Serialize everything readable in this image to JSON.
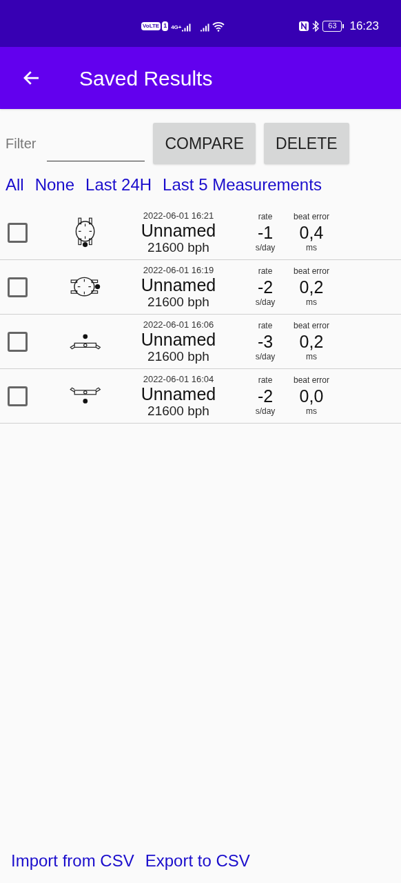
{
  "status_bar": {
    "volte": "VoLTE",
    "sim": "1",
    "network": "4G+",
    "battery": "63",
    "time": "16:23"
  },
  "app_bar": {
    "title": "Saved Results"
  },
  "filter": {
    "label": "Filter",
    "buttons": [
      "COMPARE",
      "DELETE"
    ]
  },
  "quick_select": [
    "All",
    "None",
    "Last 24H",
    "Last 5 Measurements"
  ],
  "results": [
    {
      "checked": false,
      "kind": "crown_down",
      "date": "2022-06-01 16:21",
      "name": "Unnamed",
      "bph": "21600 bph",
      "rate_label": "rate",
      "rate": "-1",
      "rate_unit": "s/day",
      "beat_label": "beat error",
      "beat": "0,4",
      "beat_unit": "ms"
    },
    {
      "checked": false,
      "kind": "crown_right",
      "date": "2022-06-01 16:19",
      "name": "Unnamed",
      "bph": "21600 bph",
      "rate_label": "rate",
      "rate": "-2",
      "rate_unit": "s/day",
      "beat_label": "beat error",
      "beat": "0,2",
      "beat_unit": "ms"
    },
    {
      "checked": false,
      "kind": "dial_up",
      "date": "2022-06-01 16:06",
      "name": "Unnamed",
      "bph": "21600 bph",
      "rate_label": "rate",
      "rate": "-3",
      "rate_unit": "s/day",
      "beat_label": "beat error",
      "beat": "0,2",
      "beat_unit": "ms"
    },
    {
      "checked": false,
      "kind": "dial_down",
      "date": "2022-06-01 16:04",
      "name": "Unnamed",
      "bph": "21600 bph",
      "rate_label": "rate",
      "rate": "-2",
      "rate_unit": "s/day",
      "beat_label": "beat error",
      "beat": "0,0",
      "beat_unit": "ms"
    }
  ],
  "footer_links": [
    "Import from CSV",
    "Export to CSV"
  ]
}
